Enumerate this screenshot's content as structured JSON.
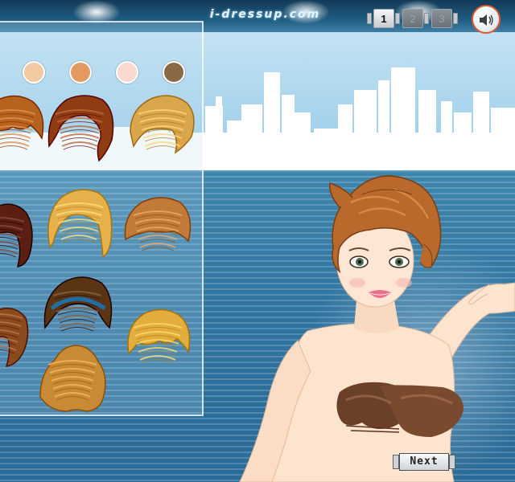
{
  "header": {
    "site_logo": "i-dressup.com",
    "pages": [
      {
        "label": "1",
        "active": true
      },
      {
        "label": "2",
        "active": false
      },
      {
        "label": "3",
        "active": false
      }
    ],
    "sound_icon": "speaker-icon"
  },
  "wardrobe": {
    "category": "hairstyles",
    "swatches": [
      "#f2c9a0",
      "#e49a5e",
      "#fbd9d1",
      "#8a6a45"
    ],
    "hairstyles": [
      {
        "id": "h1",
        "color": "#b5631f",
        "style": "short-curly"
      },
      {
        "id": "h2",
        "color": "#8f3c12",
        "style": "braided-crown-long"
      },
      {
        "id": "h3",
        "color": "#d9a64b",
        "style": "updo-wispy"
      },
      {
        "id": "h4",
        "color": "#5a1f12",
        "style": "dark-bob"
      },
      {
        "id": "h5",
        "color": "#e6b14a",
        "style": "braided-headband-long"
      },
      {
        "id": "h6",
        "color": "#c27a3a",
        "style": "short-wavy"
      },
      {
        "id": "h7",
        "color": "#8a4a1e",
        "style": "side-waves"
      },
      {
        "id": "h8",
        "color": "#5b3513",
        "style": "blue-ribbon-braid"
      },
      {
        "id": "h9",
        "color": "#e2ad3d",
        "style": "short-curly"
      },
      {
        "id": "h10",
        "color": "#c98a35",
        "style": "braided-bun"
      }
    ]
  },
  "model": {
    "hair_color": "#b8692b",
    "top": "brown-bandeau",
    "top_color": "#6b4028"
  },
  "next_button": {
    "label": "Next"
  }
}
